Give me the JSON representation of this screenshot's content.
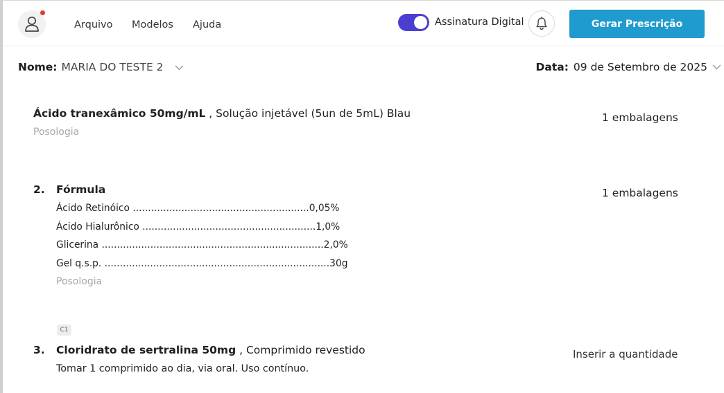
{
  "header": {
    "menu": [
      "Arquivo",
      "Modelos",
      "Ajuda"
    ],
    "signature_label": "Assinatura Digital",
    "signature_enabled": true,
    "generate_button": "Gerar Prescrição",
    "accent_color": "#1f9bd0",
    "toggle_color": "#4b3fd1",
    "notification_dot_color": "#e53935"
  },
  "patient": {
    "name_label": "Nome:",
    "name_value": "MARIA DO TESTE 2",
    "date_label": "Data:",
    "date_value": "09 de Setembro de 2025"
  },
  "items": {
    "first": {
      "drug_name": "Ácido tranexâmico 50mg/mL",
      "drug_details": " , Solução injetável (5un de 5mL) Blau",
      "posologia": "Posologia",
      "quantity": "1 embalagens"
    },
    "second": {
      "number": "2.",
      "title": "Fórmula",
      "formula": [
        "Ácido Retinóico ..........................................................0,05%",
        "Ácido Hialurônico .........................................................1,0%",
        "Glicerina .........................................................................2,0%",
        "Gel q.s.p. ..........................................................................30g"
      ],
      "posologia": "Posologia",
      "quantity": "1 embalagens"
    },
    "third": {
      "badge": "C1",
      "number": "3.",
      "drug_name": "Cloridrato de sertralina 50mg",
      "drug_details": " , Comprimido revestido",
      "instructions": "Tomar 1 comprimido ao dia, via oral. Uso contínuo.",
      "quantity": "Inserir a quantidade"
    }
  },
  "icons": {
    "avatar": "user-icon",
    "bell": "bell-icon",
    "chevron": "chevron-down-icon"
  }
}
